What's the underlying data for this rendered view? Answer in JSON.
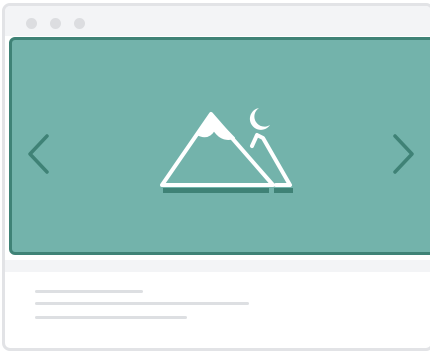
{
  "window": {
    "controls": [
      "close",
      "minimize",
      "maximize"
    ]
  },
  "carousel": {
    "background_color": "#73b3ab",
    "accent_color": "#3f8276",
    "prev_icon": "chevron-left-icon",
    "next_icon": "chevron-right-icon",
    "image_icon": "mountain-moon-image-icon"
  },
  "content": {
    "text_lines": 3
  }
}
